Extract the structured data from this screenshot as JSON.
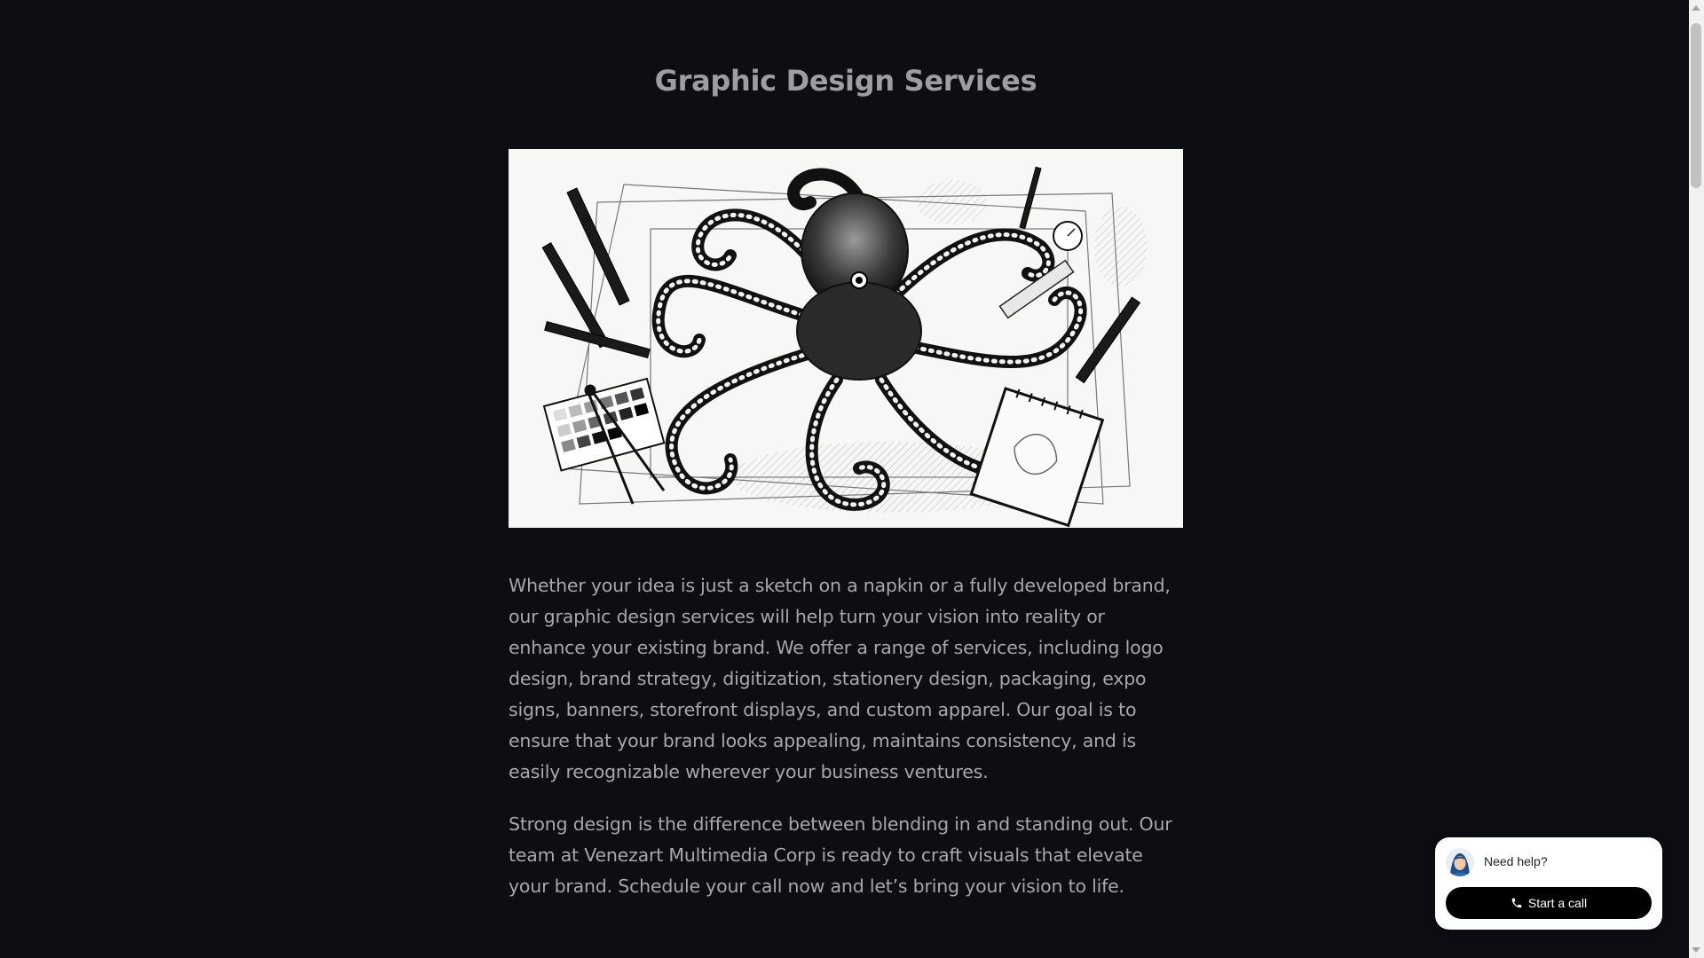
{
  "page": {
    "title": "Graphic Design Services",
    "paragraphs": [
      "Whether your idea is just a sketch on a napkin or a fully developed brand, our graphic design services will help turn your vision into reality or enhance your existing brand. We offer a range of services, including logo design, brand strategy, digitization, stationery design, packaging, expo signs, banners, storefront displays, and custom apparel. Our goal is to ensure that your brand looks appealing, maintains consistency, and is easily recognizable wherever your business ventures.",
      "Strong design is the difference between blending in and standing out. Our team at Venezart Multimedia Corp is ready to craft visuals that elevate your brand. Schedule your call now and let’s bring your vision to life."
    ]
  },
  "help_widget": {
    "prompt": "Need help?",
    "call_label": "Start a call",
    "avatar_icon": "support-agent-avatar",
    "call_icon": "phone-icon"
  },
  "colors": {
    "background": "#0c0e14",
    "title": "#9d9da3",
    "body_text": "#a7a7ad",
    "widget_bg": "#ffffff",
    "call_button_bg": "#000000"
  }
}
